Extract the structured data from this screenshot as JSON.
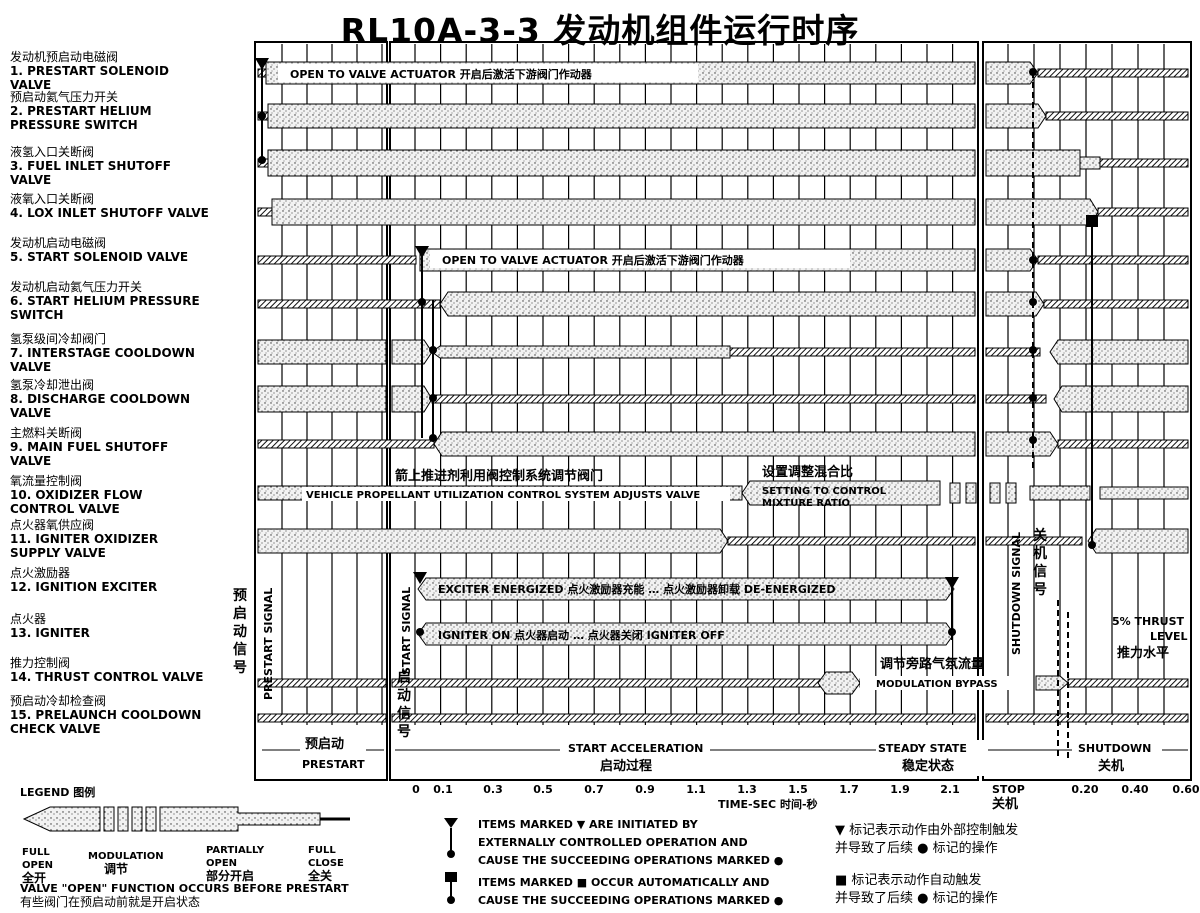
{
  "title": "RL10A-3-3 发动机组件运行时序",
  "rows": [
    {
      "zh": "发动机预启动电磁阀",
      "en": "1. PRESTART SOLENOID VALVE"
    },
    {
      "zh": "预启动氦气压力开关",
      "en": "2. PRESTART HELIUM PRESSURE SWITCH"
    },
    {
      "zh": "液氢入口关断阀",
      "en": "3. FUEL INLET SHUTOFF VALVE"
    },
    {
      "zh": "液氧入口关断阀",
      "en": "4. LOX INLET SHUTOFF VALVE"
    },
    {
      "zh": "发动机启动电磁阀",
      "en": "5. START SOLENOID VALVE"
    },
    {
      "zh": "发动机启动氦气压力开关",
      "en": "6. START HELIUM PRESSURE SWITCH"
    },
    {
      "zh": "氢泵级间冷却阀门",
      "en": "7. INTERSTAGE COOLDOWN VALVE"
    },
    {
      "zh": "氢泵冷却泄出阀",
      "en": "8. DISCHARGE COOLDOWN VALVE"
    },
    {
      "zh": "主燃料关断阀",
      "en": "9. MAIN FUEL SHUTOFF VALVE"
    },
    {
      "zh": "氧流量控制阀",
      "en": "10. OXIDIZER FLOW CONTROL VALVE"
    },
    {
      "zh": "点火器氧供应阀",
      "en": "11. IGNITER OXIDIZER SUPPLY VALVE"
    },
    {
      "zh": "点火激励器",
      "en": "12. IGNITION EXCITER"
    },
    {
      "zh": "点火器",
      "en": "13. IGNITER"
    },
    {
      "zh": "推力控制阀",
      "en": "14. THRUST CONTROL VALVE"
    },
    {
      "zh": "预启动冷却检查阀",
      "en": "15. PRELAUNCH COOLDOWN CHECK VALVE"
    }
  ],
  "annotations": {
    "open_actuator_1": "OPEN TO VALVE ACTUATOR 开启后激活下游阀门作动器",
    "open_actuator_5": "OPEN TO VALVE ACTUATOR 开启后激活下游阀门作动器",
    "pu_zh": "箭上推进剂利用阀控制系统调节阀门",
    "pu_en": "VEHICLE PROPELLANT UTILIZATION CONTROL SYSTEM ADJUSTS VALVE",
    "mixture_zh": "设置调整混合比",
    "mixture_en_1": "SETTING TO CONTROL",
    "mixture_en_2": "MIXTURE RATIO",
    "exciter": "EXCITER ENERGIZED 点火激励器充能 … 点火激励器卸载 DE-ENERGIZED",
    "igniter": "IGNITER ON 点火器启动 … 点火器关闭 IGNITER OFF",
    "bypass_zh": "调节旁路气氛流量",
    "bypass_en": "MODULATION BYPASS",
    "thrust_level_en_1": "5% THRUST",
    "thrust_level_en_2": "LEVEL",
    "thrust_level_zh": "推力水平"
  },
  "signals": {
    "prestart_en": "PRESTART SIGNAL",
    "prestart_zh": [
      "预",
      "启",
      "动",
      "信",
      "号"
    ],
    "start_en": "START SIGNAL",
    "start_zh": [
      "启",
      "动",
      "信",
      "号"
    ],
    "shutdown_en": "SHUTDOWN SIGNAL",
    "shutdown_zh": [
      "关",
      "机",
      "信",
      "号"
    ]
  },
  "phases": {
    "prestart_zh": "预启动",
    "prestart_en": "PRESTART",
    "start_en": "START ACCELERATION",
    "start_zh": "启动过程",
    "steady_en": "STEADY STATE",
    "steady_zh": "稳定状态",
    "shutdown_en": "SHUTDOWN",
    "shutdown_zh": "关机"
  },
  "time_axis": {
    "ticks_run": [
      "0",
      "0.1",
      "0.3",
      "0.5",
      "0.7",
      "0.9",
      "1.1",
      "1.3",
      "1.5",
      "1.7",
      "1.9",
      "2.1"
    ],
    "ticks_shutdown": [
      "0.20",
      "0.40",
      "0.60"
    ],
    "stop_en": "STOP",
    "stop_zh": "关机",
    "label": "TIME-SEC 时间-秒"
  },
  "legend": {
    "title": "LEGEND 图例",
    "full_open_en": "FULL OPEN",
    "full_open_zh": "全开",
    "modulation_en": "MODULATION",
    "modulation_zh": "调节",
    "partial_en": "PARTIALLY OPEN",
    "partial_zh": "部分开启",
    "full_close_en": "FULL CLOSE",
    "full_close_zh": "全关",
    "note_en": "VALVE \"OPEN\" FUNCTION OCCURS BEFORE PRESTART",
    "note_zh": "有些阀门在预启动前就是开启状态"
  },
  "key": {
    "tri_en_1": "ITEMS MARKED ▼ ARE INITIATED BY",
    "tri_en_2": "EXTERNALLY CONTROLLED OPERATION AND",
    "tri_en_3": "CAUSE THE SUCCEEDING OPERATIONS MARKED ●",
    "tri_zh_1": "▼ 标记表示动作由外部控制触发",
    "tri_zh_2": "并导致了后续 ● 标记的操作",
    "sq_en_1": "ITEMS MARKED ■ OCCUR AUTOMATICALLY AND",
    "sq_en_2": "CAUSE THE SUCCEEDING OPERATIONS MARKED ●",
    "sq_zh_1": "■ 标记表示动作自动触发",
    "sq_zh_2": "并导致了后续 ● 标记的操作"
  }
}
